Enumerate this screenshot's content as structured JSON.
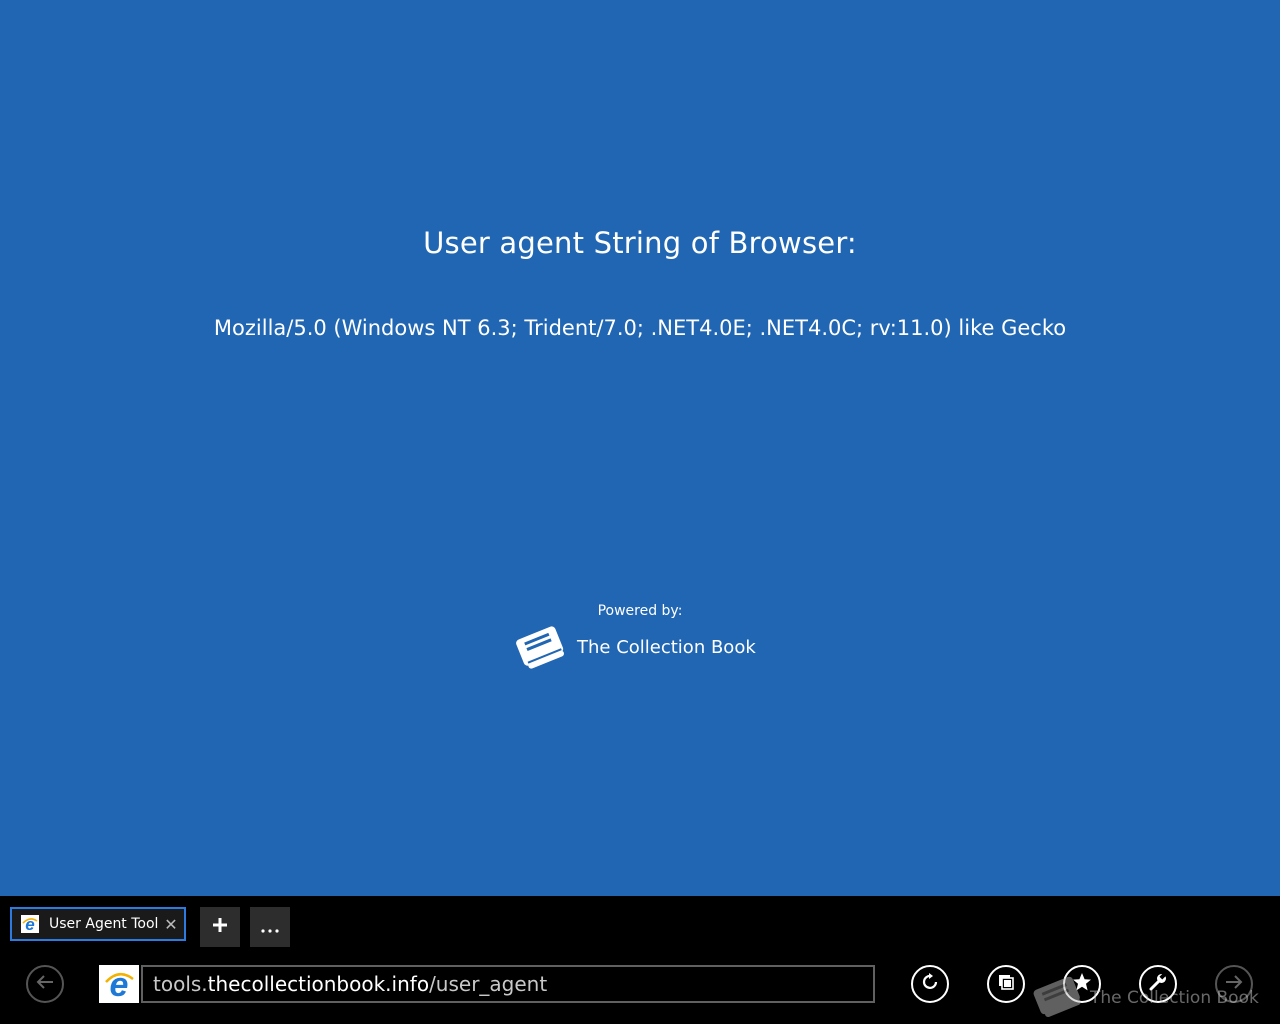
{
  "page": {
    "heading": "User agent String of Browser:",
    "user_agent": "Mozilla/5.0 (Windows NT 6.3; Trident/7.0; .NET4.0E; .NET4.0C; rv:11.0) like Gecko",
    "powered_by_label": "Powered by:",
    "brand_name": "The Collection Book",
    "background_color": "#2066b3"
  },
  "browser": {
    "tab": {
      "title": "User Agent Tool",
      "close_glyph": "✕"
    },
    "new_tab_glyph": "+",
    "more_glyph": "···",
    "address": {
      "prefix": "tools.",
      "domain": "thecollectionbook.info",
      "path": "/user_agent"
    },
    "buttons": {
      "back": "back-icon",
      "refresh": "refresh-icon",
      "pages": "pages-icon",
      "favorites": "favorites-icon",
      "tools": "wrench-icon",
      "forward": "forward-icon"
    },
    "accent_color": "#2e7be0"
  },
  "watermark": {
    "text": "The Collection Book"
  }
}
